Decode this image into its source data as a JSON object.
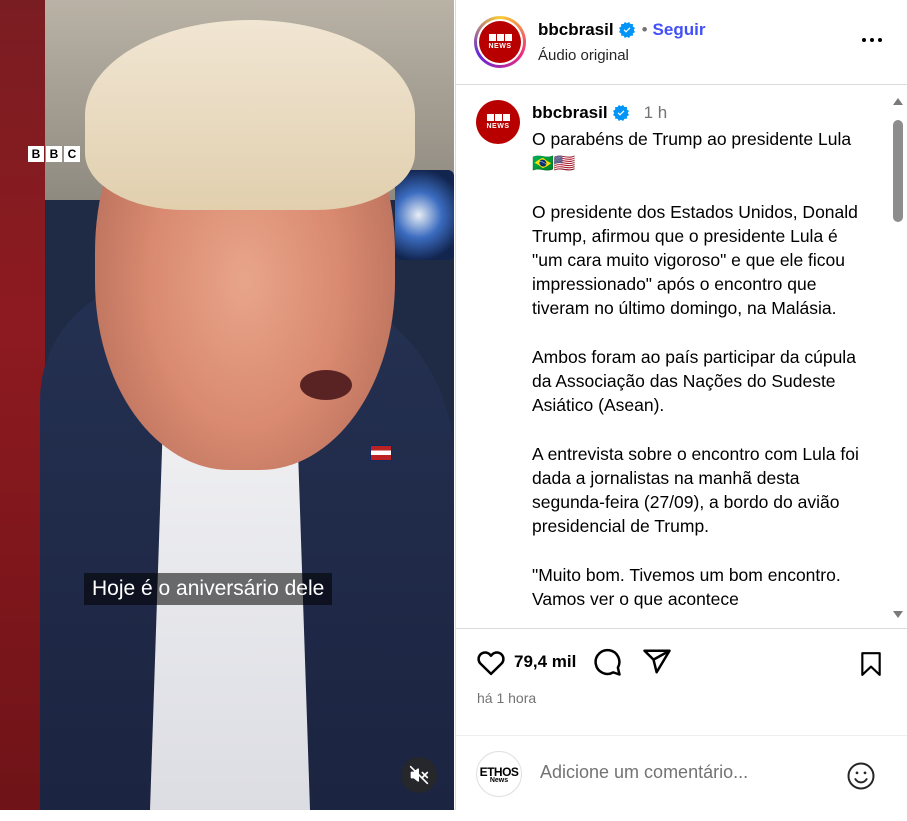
{
  "video": {
    "watermark_letters": [
      "B",
      "B",
      "C"
    ],
    "caption": "Hoje é o aniversário dele",
    "mute_icon": "speaker-muted-icon"
  },
  "header": {
    "username": "bbcbrasil",
    "avatar_letters": [
      "B",
      "B",
      "C"
    ],
    "avatar_sub": "NEWS",
    "separator": "•",
    "follow_label": "Seguir",
    "audio_label": "Áudio original",
    "more_icon": "more-options-icon"
  },
  "caption": {
    "username": "bbcbrasil",
    "time": "1 h",
    "text": "O parabéns de Trump ao presidente Lula🇧🇷🇺🇸\n\nO presidente dos Estados Unidos, Donald Trump, afirmou que o presidente Lula é \"um cara muito vigoroso\" e que ele ficou impressionado\" após o encontro que tiveram no último domingo, na Malásia.\n\nAmbos foram ao país participar da cúpula da Associação das Nações do Sudeste Asiático (Asean).\n\nA entrevista sobre o encontro com Lula foi dada a jornalistas na manhã desta segunda-feira (27/09), a bordo do avião presidencial de Trump.\n\n\"Muito bom. Tivemos um bom encontro. Vamos ver o que acontece"
  },
  "actions": {
    "likes": "79,4 mil",
    "time_ago": "há 1 hora"
  },
  "add_comment": {
    "placeholder": "Adicione um comentário...",
    "avatar_top": "ETHOS",
    "avatar_bottom": "News"
  },
  "colors": {
    "follow": "#4150f7",
    "bbc_red": "#b80000",
    "verified": "#0095f6"
  }
}
